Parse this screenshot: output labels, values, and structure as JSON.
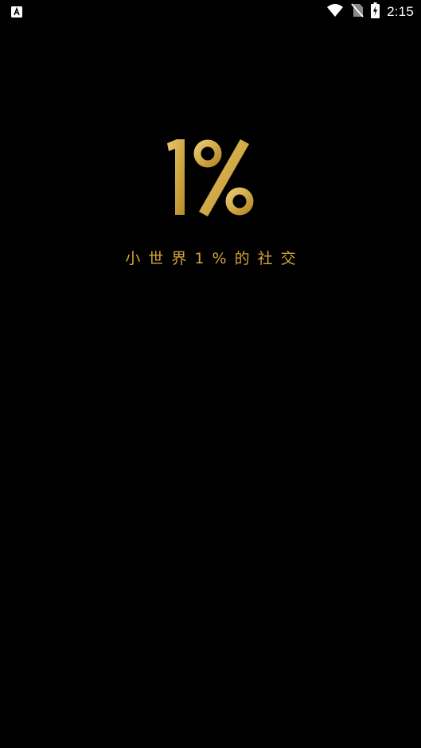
{
  "status_bar": {
    "time": "2:15",
    "icons": [
      "app-notification-icon",
      "wifi-icon",
      "no-sim-icon",
      "battery-charging-icon"
    ]
  },
  "splash": {
    "logo_text": "1%",
    "tagline": "小世界1%的社交"
  },
  "colors": {
    "background": "#000000",
    "gold_light": "#e8c874",
    "gold_dark": "#b8892a",
    "tagline": "#d4a43a"
  }
}
